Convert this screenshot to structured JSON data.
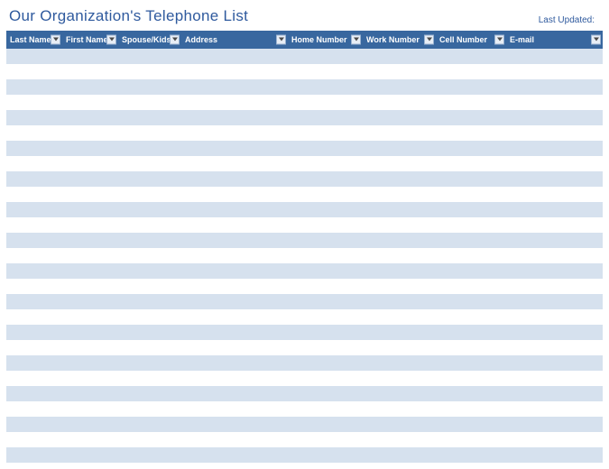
{
  "header": {
    "title": "Our Organization's Telephone List",
    "last_updated_label": "Last Updated:"
  },
  "table": {
    "columns": [
      {
        "label": "Last Name"
      },
      {
        "label": "First Name"
      },
      {
        "label": "Spouse/Kids"
      },
      {
        "label": "Address"
      },
      {
        "label": "Home Number"
      },
      {
        "label": "Work Number"
      },
      {
        "label": "Cell Number"
      },
      {
        "label": "E-mail"
      }
    ],
    "rows": [
      [
        "",
        "",
        "",
        "",
        "",
        "",
        "",
        ""
      ],
      [
        "",
        "",
        "",
        "",
        "",
        "",
        "",
        ""
      ],
      [
        "",
        "",
        "",
        "",
        "",
        "",
        "",
        ""
      ],
      [
        "",
        "",
        "",
        "",
        "",
        "",
        "",
        ""
      ],
      [
        "",
        "",
        "",
        "",
        "",
        "",
        "",
        ""
      ],
      [
        "",
        "",
        "",
        "",
        "",
        "",
        "",
        ""
      ],
      [
        "",
        "",
        "",
        "",
        "",
        "",
        "",
        ""
      ],
      [
        "",
        "",
        "",
        "",
        "",
        "",
        "",
        ""
      ],
      [
        "",
        "",
        "",
        "",
        "",
        "",
        "",
        ""
      ],
      [
        "",
        "",
        "",
        "",
        "",
        "",
        "",
        ""
      ],
      [
        "",
        "",
        "",
        "",
        "",
        "",
        "",
        ""
      ],
      [
        "",
        "",
        "",
        "",
        "",
        "",
        "",
        ""
      ],
      [
        "",
        "",
        "",
        "",
        "",
        "",
        "",
        ""
      ],
      [
        "",
        "",
        "",
        "",
        "",
        "",
        "",
        ""
      ],
      [
        "",
        "",
        "",
        "",
        "",
        "",
        "",
        ""
      ],
      [
        "",
        "",
        "",
        "",
        "",
        "",
        "",
        ""
      ],
      [
        "",
        "",
        "",
        "",
        "",
        "",
        "",
        ""
      ],
      [
        "",
        "",
        "",
        "",
        "",
        "",
        "",
        ""
      ],
      [
        "",
        "",
        "",
        "",
        "",
        "",
        "",
        ""
      ],
      [
        "",
        "",
        "",
        "",
        "",
        "",
        "",
        ""
      ],
      [
        "",
        "",
        "",
        "",
        "",
        "",
        "",
        ""
      ],
      [
        "",
        "",
        "",
        "",
        "",
        "",
        "",
        ""
      ],
      [
        "",
        "",
        "",
        "",
        "",
        "",
        "",
        ""
      ],
      [
        "",
        "",
        "",
        "",
        "",
        "",
        "",
        ""
      ],
      [
        "",
        "",
        "",
        "",
        "",
        "",
        "",
        ""
      ],
      [
        "",
        "",
        "",
        "",
        "",
        "",
        "",
        ""
      ],
      [
        "",
        "",
        "",
        "",
        "",
        "",
        "",
        ""
      ]
    ]
  }
}
